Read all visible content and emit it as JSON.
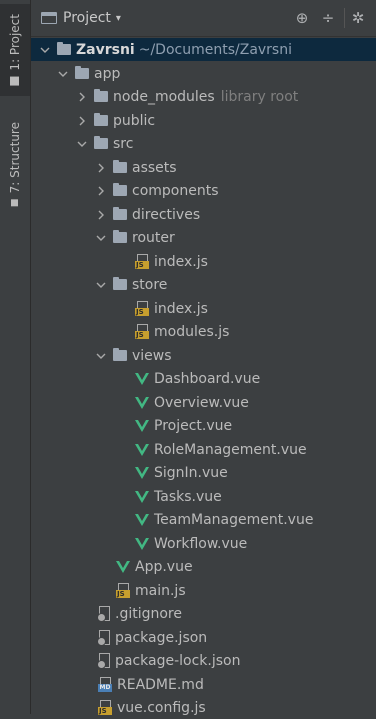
{
  "sidebar": {
    "tabs": [
      {
        "label": "1: Project",
        "active": true
      },
      {
        "label": "7: Structure",
        "active": false
      }
    ]
  },
  "toolbar": {
    "title": "Project",
    "icons": [
      "crosshair-icon",
      "collapse-icon",
      "gear-icon"
    ]
  },
  "tree": {
    "root": {
      "label": "Zavrsni",
      "path": "~/Documents/Zavrsni"
    },
    "items": [
      {
        "label": "app",
        "kind": "folder"
      },
      {
        "label": "node_modules",
        "kind": "folder",
        "suffix": "library root"
      },
      {
        "label": "public",
        "kind": "folder"
      },
      {
        "label": "src",
        "kind": "folder"
      },
      {
        "label": "assets",
        "kind": "folder"
      },
      {
        "label": "components",
        "kind": "folder"
      },
      {
        "label": "directives",
        "kind": "folder"
      },
      {
        "label": "router",
        "kind": "folder"
      },
      {
        "label": "index.js",
        "kind": "js"
      },
      {
        "label": "store",
        "kind": "folder"
      },
      {
        "label": "index.js",
        "kind": "js"
      },
      {
        "label": "modules.js",
        "kind": "js"
      },
      {
        "label": "views",
        "kind": "folder"
      },
      {
        "label": "Dashboard.vue",
        "kind": "vue"
      },
      {
        "label": "Overview.vue",
        "kind": "vue"
      },
      {
        "label": "Project.vue",
        "kind": "vue"
      },
      {
        "label": "RoleManagement.vue",
        "kind": "vue"
      },
      {
        "label": "SignIn.vue",
        "kind": "vue"
      },
      {
        "label": "Tasks.vue",
        "kind": "vue"
      },
      {
        "label": "TeamManagement.vue",
        "kind": "vue"
      },
      {
        "label": "Workflow.vue",
        "kind": "vue"
      },
      {
        "label": "App.vue",
        "kind": "vue"
      },
      {
        "label": "main.js",
        "kind": "js"
      },
      {
        "label": ".gitignore",
        "kind": "file"
      },
      {
        "label": "package.json",
        "kind": "config"
      },
      {
        "label": "package-lock.json",
        "kind": "config"
      },
      {
        "label": "README.md",
        "kind": "md"
      },
      {
        "label": "vue.config.js",
        "kind": "js"
      }
    ]
  },
  "colors": {
    "background": "#3c3f41",
    "selected_row": "#0d293e",
    "vue_green": "#42b883",
    "js_yellow": "#c79f2e"
  }
}
